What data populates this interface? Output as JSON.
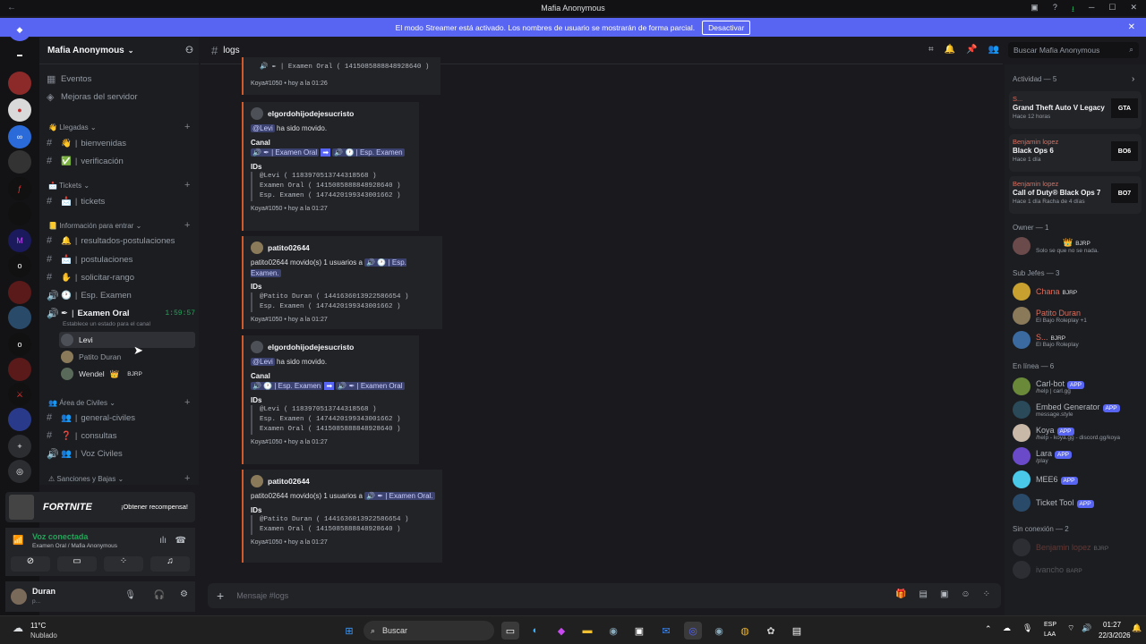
{
  "window": {
    "title": "Mafia Anonymous",
    "back_icon": "arrow-left-icon"
  },
  "banner": {
    "text": "El modo Streamer está activado. Los nombres de usuario se mostrarán de forma parcial.",
    "button": "Desactivar"
  },
  "server": {
    "name": "Mafia Anonymous"
  },
  "sidebar": {
    "top_items": [
      {
        "label": "Eventos"
      },
      {
        "label": "Mejoras del servidor"
      }
    ],
    "categories": {
      "llegadas": "Llegadas",
      "tickets": "Tickets",
      "info": "Información para entrar",
      "civiles": "Área de Civiles",
      "sanciones": "Sanciones y Bajas"
    },
    "channels": {
      "bienvenidas": "bienvenidas",
      "verificacion": "verificación",
      "tickets": "tickets",
      "resultados": "resultados-postulaciones",
      "postulaciones": "postulaciones",
      "solicitar": "solicitar-rango",
      "esp_examen": "Esp. Examen",
      "examen_oral": "Examen Oral",
      "examen_time": "1:59:57",
      "examen_status": "Establece un estado para el canal",
      "general": "general-civiles",
      "consultas": "consultas",
      "voz": "Voz Civiles"
    },
    "voice_users": [
      {
        "name": "Levi"
      },
      {
        "name": "Patito Duran"
      },
      {
        "name": "Wendel",
        "tag": "BJRP"
      }
    ]
  },
  "promo": {
    "game": "FORTNITE",
    "button": "¡Obtener recompensa!"
  },
  "voice": {
    "status": "Voz conectada",
    "channel": "Examen Oral / Mafia Anonymous"
  },
  "user": {
    "name": "Duran",
    "status": "p..."
  },
  "channel": {
    "name": "logs"
  },
  "search": {
    "placeholder": "Buscar Mafia Anonymous"
  },
  "messages": {
    "top_partial": {
      "line": "Examen Oral ( 1415085888848928640 )",
      "footer": "Koya#1050 • hoy a la 01:26"
    },
    "m1": {
      "author": "elgordohijodejesucristo",
      "mention": "@Levi",
      "text": "ha sido movido.",
      "canal_label": "Canal",
      "from": "Examen Oral",
      "to": "Esp. Examen",
      "ids_label": "IDs",
      "id1": "@Levi ( 1183970513744318568 )",
      "id2": "Examen Oral ( 1415085888848928640 )",
      "id3": "Esp. Examen ( 1474420199343001662 )",
      "footer": "Koya#1050 • hoy a la 01:27"
    },
    "m2": {
      "author": "patito02644",
      "line": "patito02644 movido(s) 1 usuarios a",
      "target": "Esp. Examen.",
      "ids_label": "IDs",
      "id1": "@Patito Duran ( 1441636013922586654 )",
      "id2": "Esp. Examen ( 1474420199343001662 )",
      "footer": "Koya#1050 • hoy a la 01:27"
    },
    "m3": {
      "author": "elgordohijodejesucristo",
      "mention": "@Levi",
      "text": "ha sido movido.",
      "canal_label": "Canal",
      "from": "Esp. Examen",
      "to": "Examen Oral",
      "ids_label": "IDs",
      "id1": "@Levi ( 1183970513744318568 )",
      "id2": "Esp. Examen ( 1474420199343001662 )",
      "id3": "Examen Oral ( 1415085888848928640 )",
      "footer": "Koya#1050 • hoy a la 01:27"
    },
    "m4": {
      "author": "patito02644",
      "line": "patito02644 movido(s) 1 usuarios a",
      "target": "Examen Oral.",
      "ids_label": "IDs",
      "id1": "@Patito Duran ( 1441636013922586654 )",
      "id2": "Examen Oral ( 1415085888848928640 )",
      "footer": "Koya#1050 • hoy a la 01:27"
    }
  },
  "composer": {
    "placeholder": "Mensaje #logs"
  },
  "members": {
    "activity_header": "Actividad — 5",
    "activities": [
      {
        "user": "S...",
        "game": "Grand Theft Auto V Legacy",
        "sub": "Hace 12 horas",
        "img": "GTA"
      },
      {
        "user": "Benjamin lopez",
        "game": "Black Ops 6",
        "sub": "Hace 1 día",
        "img": "BO6"
      },
      {
        "user": "Benjamin lopez",
        "game": "Call of Duty® Black Ops 7",
        "sub": "Hace 1 día  Racha de 4 días",
        "img": "BO7"
      }
    ],
    "owner_header": "Owner — 1",
    "owner": {
      "tag": "BJRP",
      "status": "Solo se que no se nada."
    },
    "subjefes_header": "Sub Jefes — 3",
    "subjefes": [
      {
        "name": "Chana",
        "tag": "BJRP",
        "sub": ""
      },
      {
        "name": "Patito Duran",
        "tag": "",
        "sub": "El Bajo Roleplay +1"
      },
      {
        "name": "S...",
        "tag": "BJRP",
        "sub": "El Bajo Roleplay"
      }
    ],
    "online_header": "En línea — 6",
    "online": [
      {
        "name": "Carl-bot",
        "tag": "APP",
        "sub": "/help | carl.gg"
      },
      {
        "name": "Embed Generator",
        "tag": "APP",
        "sub": "message.style"
      },
      {
        "name": "Koya",
        "tag": "APP",
        "sub": "/help - koya.gg - discord.gg/koya"
      },
      {
        "name": "Lara",
        "tag": "APP",
        "sub": "/play"
      },
      {
        "name": "MEE6",
        "tag": "APP",
        "sub": ""
      },
      {
        "name": "Ticket Tool",
        "tag": "APP",
        "sub": ""
      }
    ],
    "offline_header": "Sin conexión — 2",
    "offline": [
      {
        "name": "Benjamin lopez",
        "tag": "BJRP"
      },
      {
        "name": "ivancho",
        "tag": "BARP"
      }
    ]
  },
  "taskbar": {
    "weather_temp": "11°C",
    "weather_desc": "Nublado",
    "search": "Buscar",
    "lang1": "ESP",
    "lang2": "LAA",
    "time": "01:27",
    "date": "22/3/2026"
  }
}
